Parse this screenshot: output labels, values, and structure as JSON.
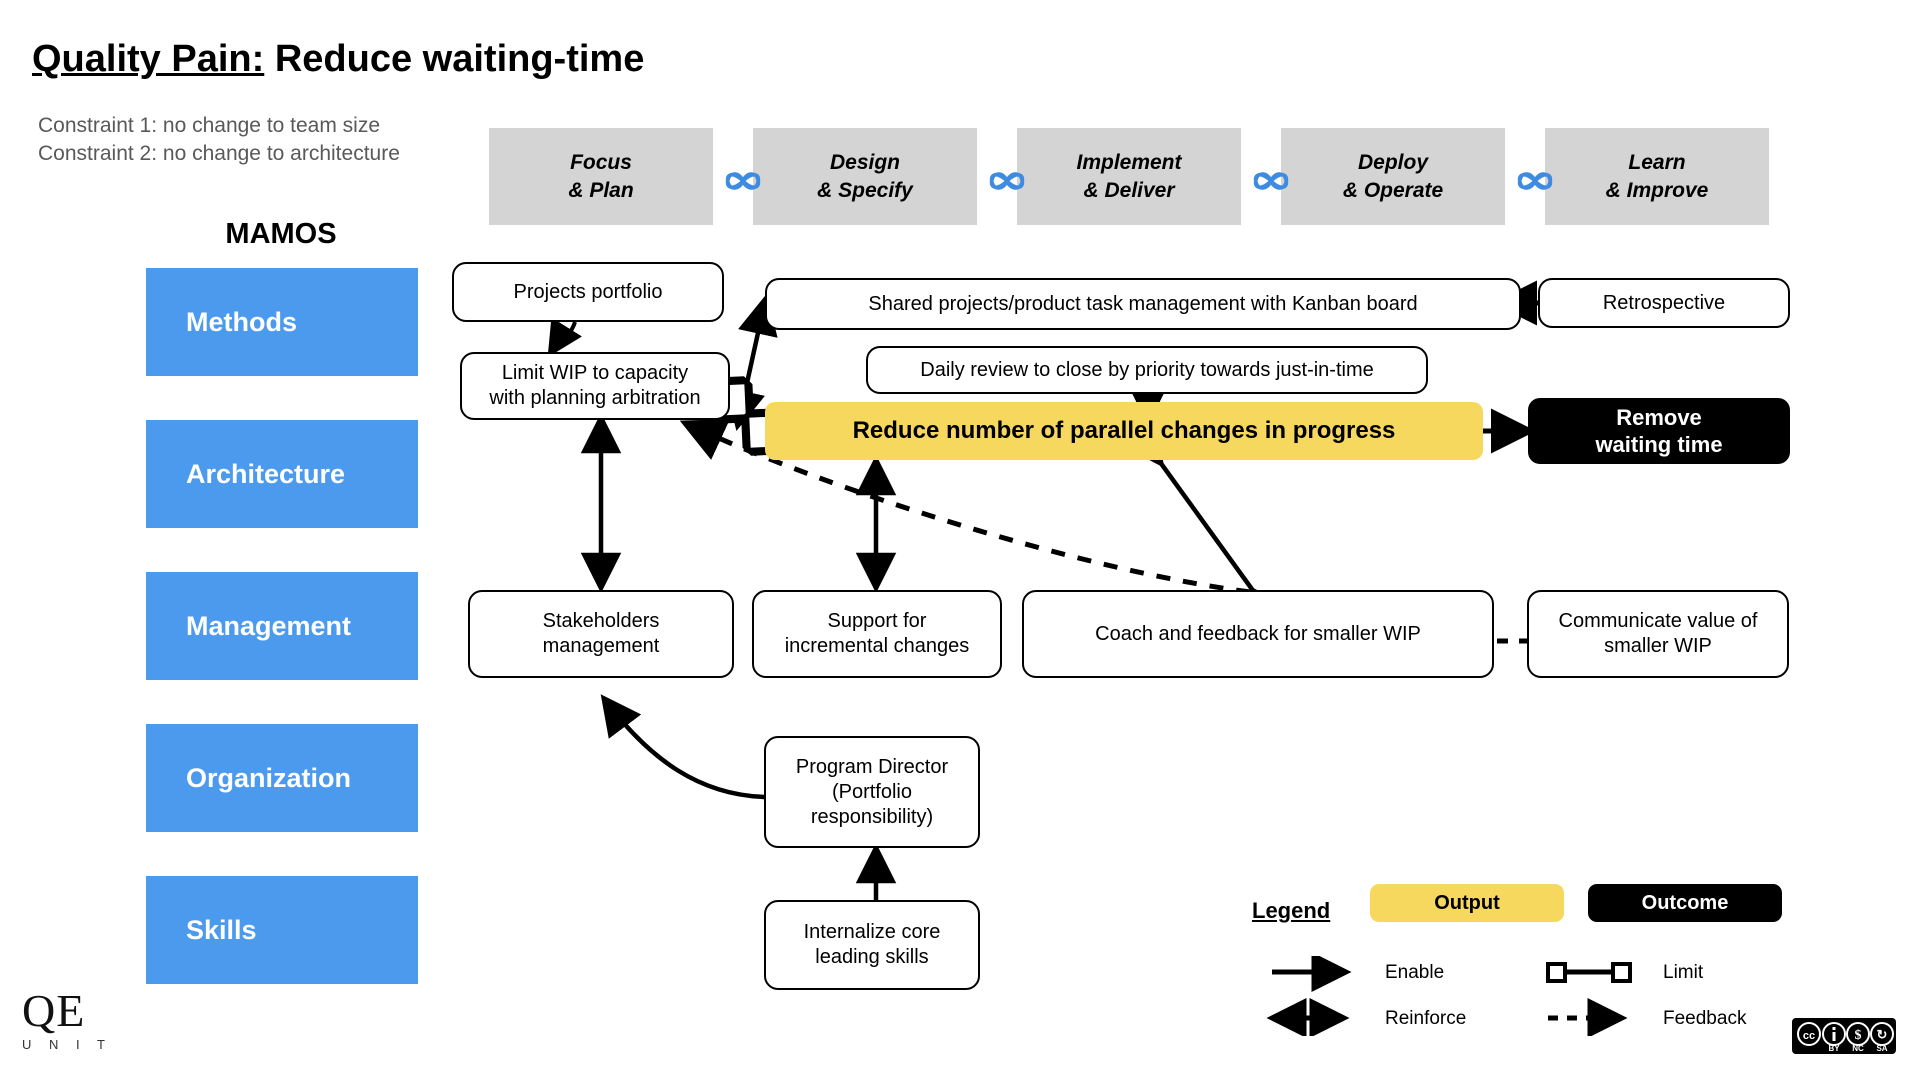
{
  "title": {
    "underlined": "Quality Pain:",
    "rest": " Reduce waiting-time"
  },
  "constraints": {
    "line1": "Constraint 1: no change to team size",
    "line2": "Constraint 2: no change to architecture"
  },
  "sidebar": {
    "heading": "MAMOS",
    "accent_color": "#4c9aed",
    "items": [
      {
        "label": "Methods"
      },
      {
        "label": "Architecture"
      },
      {
        "label": "Management"
      },
      {
        "label": "Organization"
      },
      {
        "label": "Skills"
      }
    ]
  },
  "phases": {
    "separator_icon": "knot-icon",
    "separator_color": "#3d8ce0",
    "background": "#d4d4d4",
    "items": [
      {
        "line1": "Focus",
        "line2": "& Plan"
      },
      {
        "line1": "Design",
        "line2": "& Specify"
      },
      {
        "line1": "Implement",
        "line2": "& Deliver"
      },
      {
        "line1": "Deploy",
        "line2": "& Operate"
      },
      {
        "line1": "Learn",
        "line2": "& Improve"
      }
    ]
  },
  "nodes": {
    "projects_portfolio": "Projects portfolio",
    "limit_wip": "Limit WIP to capacity\nwith planning arbitration",
    "shared_kanban": "Shared projects/product task management with Kanban board",
    "retrospective": "Retrospective",
    "daily_review": "Daily review to close by priority towards just-in-time",
    "reduce_parallel": "Reduce number of parallel changes in progress",
    "remove_waiting": "Remove\nwaiting time",
    "stakeholders": "Stakeholders\nmanagement",
    "support_incremental": "Support for\nincremental changes",
    "coach_feedback": "Coach and feedback for smaller WIP",
    "communicate_value": "Communicate value of\nsmaller WIP",
    "program_director": "Program Director\n(Portfolio\nresponsibility)",
    "internalize_skills": "Internalize core\nleading skills"
  },
  "legend": {
    "title": "Legend",
    "output_label": "Output",
    "outcome_label": "Outcome",
    "output_color": "#f7d85e",
    "outcome_color": "#000000",
    "entries": [
      {
        "name": "enable-arrow",
        "label": "Enable"
      },
      {
        "name": "limit-line",
        "label": "Limit"
      },
      {
        "name": "reinforce-arrow",
        "label": "Reinforce"
      },
      {
        "name": "feedback-arrow",
        "label": "Feedback"
      }
    ]
  },
  "branding": {
    "logo_main": "QE",
    "logo_sub": "U N I T"
  },
  "license": {
    "cc": "CC",
    "by": "BY",
    "nc": "NC",
    "sa": "SA"
  }
}
